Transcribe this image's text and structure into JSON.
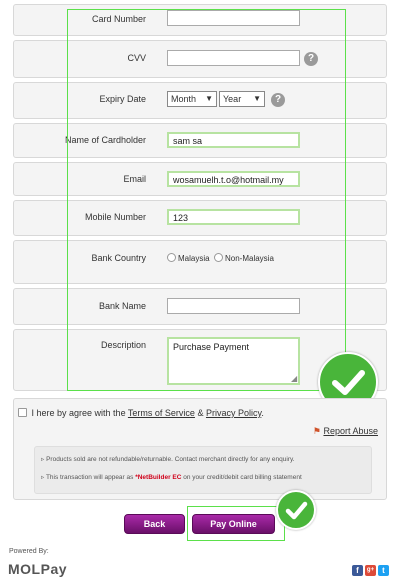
{
  "form": {
    "card_number_label": "Card Number",
    "card_number_value": "",
    "cvv_label": "CVV",
    "cvv_value": "",
    "expiry_label": "Expiry Date",
    "month_selected": "Month",
    "year_selected": "Year",
    "cardholder_label": "Name of Cardholder",
    "cardholder_value": "sam sa",
    "email_label": "Email",
    "email_value": "wosamuelh.t.o@hotmail.my",
    "mobile_label": "Mobile Number",
    "mobile_value": "123",
    "bank_country_label": "Bank Country",
    "country_options": [
      "Malaysia",
      "Non-Malaysia"
    ],
    "bank_name_label": "Bank Name",
    "bank_name_value": "",
    "description_label": "Description",
    "description_value": "Purchase Payment",
    "help_symbol": "?"
  },
  "terms": {
    "prefix": "I here by agree with the ",
    "tos_link": "Terms of Service",
    "amp": " & ",
    "privacy_link": "Privacy Policy",
    "suffix": ".",
    "report_abuse": "Report Abuse"
  },
  "notices": {
    "line1": "Products sold are not refundable/returnable. Contact merchant directly for any enquiry.",
    "line2_prefix": "This transaction will appear as ",
    "line2_merchant": "*NetBuilder EC",
    "line2_suffix": " on your credit/debit card billing statement"
  },
  "buttons": {
    "back": "Back",
    "pay_online": "Pay Online"
  },
  "footer": {
    "powered_by": "Powered By:",
    "brand": "MOLPay",
    "social": [
      "f",
      "g+",
      "t"
    ]
  },
  "colors": {
    "accent_purple": "#8a1c89",
    "highlight_green": "#5be04a",
    "check_green": "#49b53a",
    "merchant_red": "#d0021b"
  }
}
